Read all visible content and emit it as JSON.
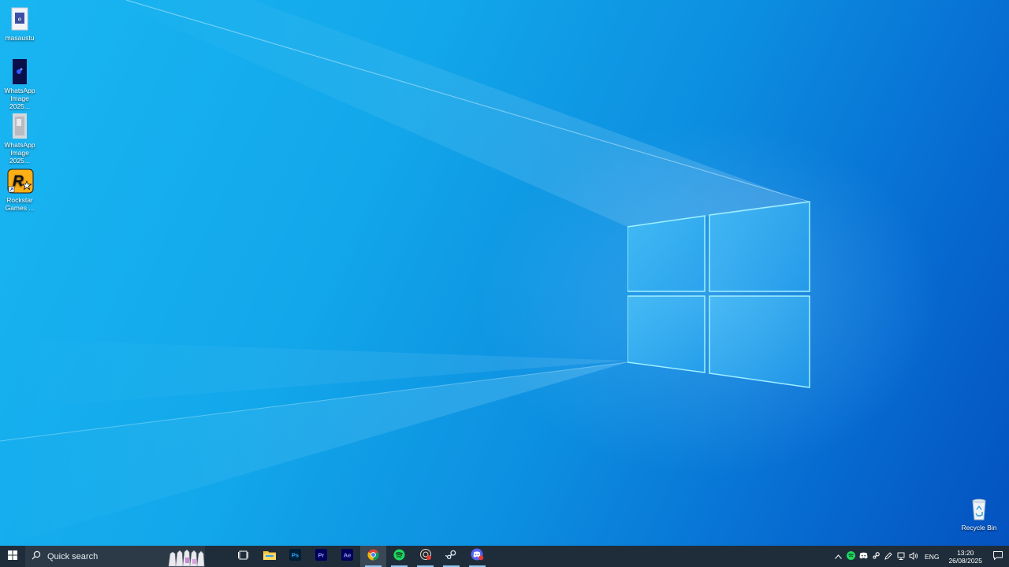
{
  "desktop": {
    "icons": [
      {
        "label": "masaustu",
        "icon": "document-image-icon"
      },
      {
        "label": "WhatsApp Image 2025...",
        "icon": "image-file-icon"
      },
      {
        "label": "WhatsApp Image 2025...",
        "icon": "image-file-icon"
      },
      {
        "label": "Rockstar Games ...",
        "icon": "rockstar-games-icon"
      }
    ],
    "recycle_bin": {
      "label": "Recycle Bin",
      "icon": "recycle-bin-icon"
    }
  },
  "taskbar": {
    "search_label": "Quick search",
    "apps": [
      {
        "name": "task-view",
        "icon": "task-view-icon",
        "glyph": "⧉"
      },
      {
        "name": "file-explorer",
        "icon": "folder-icon",
        "glyph": ""
      },
      {
        "name": "photoshop",
        "icon": "photoshop-icon",
        "glyph": "Ps"
      },
      {
        "name": "premiere-pro",
        "icon": "premiere-icon",
        "glyph": "Pr"
      },
      {
        "name": "after-effects",
        "icon": "after-effects-icon",
        "glyph": "Ae"
      },
      {
        "name": "chrome",
        "icon": "chrome-icon",
        "glyph": ""
      },
      {
        "name": "spotify",
        "icon": "spotify-icon",
        "glyph": ""
      },
      {
        "name": "obs",
        "icon": "recorder-icon",
        "glyph": ""
      },
      {
        "name": "steam",
        "icon": "steam-icon",
        "glyph": ""
      },
      {
        "name": "discord",
        "icon": "discord-icon",
        "glyph": ""
      }
    ],
    "tray": {
      "language": "ENG",
      "time": "13:20",
      "date": "26/08/2025"
    }
  },
  "colors": {
    "taskbar_bg": "#1f2d3a",
    "accent": "#8ec8f2",
    "photoshop": "#31a8ff",
    "premiere": "#9999ff",
    "after_effects": "#9999ff",
    "spotify": "#1ed760",
    "rockstar": "#fcaf17"
  }
}
